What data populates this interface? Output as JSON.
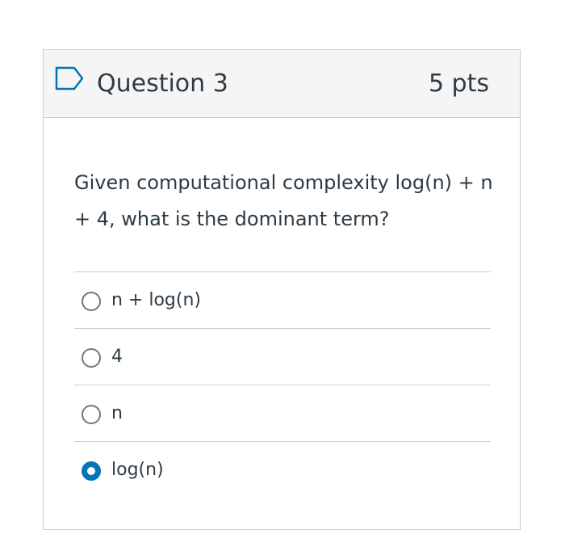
{
  "question": {
    "title": "Question 3",
    "points": "5 pts",
    "text": "Given computational complexity log(n) + n + 4, what is the dominant term?",
    "flag_icon": "flag-outline-icon",
    "options": [
      {
        "label": "n + log(n)",
        "selected": false
      },
      {
        "label": "4",
        "selected": false
      },
      {
        "label": "n",
        "selected": false
      },
      {
        "label": "log(n)",
        "selected": true
      }
    ]
  },
  "colors": {
    "accent": "#0374b5",
    "border": "#c7cdd1",
    "header_bg": "#f5f5f5",
    "text": "#2d3b45"
  }
}
